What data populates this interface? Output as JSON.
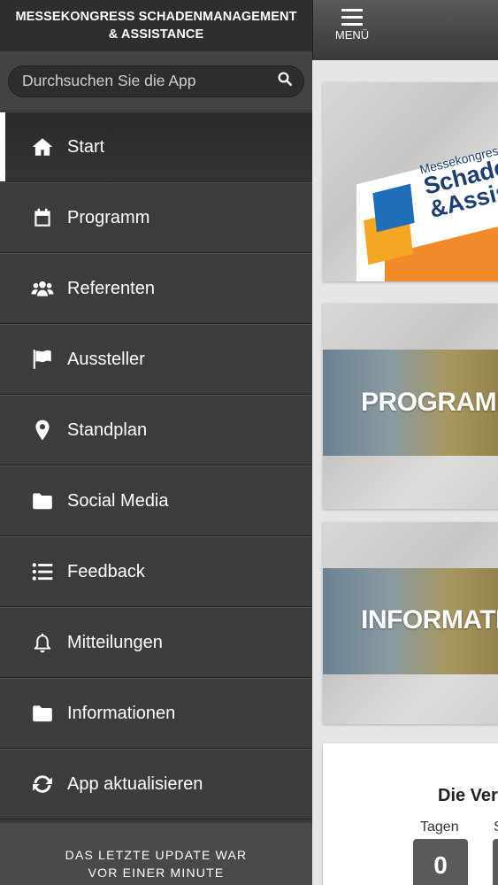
{
  "sidebar": {
    "title_line1": "MESSEKONGRESS SCHADENMANAGEMENT",
    "title_line2": "& ASSISTANCE",
    "search": {
      "placeholder": "Durchsuchen Sie die App",
      "value": ""
    },
    "items": [
      {
        "label": "Start",
        "icon": "home-icon",
        "active": true
      },
      {
        "label": "Programm",
        "icon": "calendar-icon"
      },
      {
        "label": "Referenten",
        "icon": "users-icon"
      },
      {
        "label": "Aussteller",
        "icon": "flag-icon"
      },
      {
        "label": "Standplan",
        "icon": "map-marker-icon"
      },
      {
        "label": "Social Media",
        "icon": "folder-icon"
      },
      {
        "label": "Feedback",
        "icon": "list-icon"
      },
      {
        "label": "Mitteilungen",
        "icon": "bell-icon"
      },
      {
        "label": "Informationen",
        "icon": "folder-icon"
      },
      {
        "label": "App aktualisieren",
        "icon": "refresh-icon"
      }
    ],
    "footer_line1": "DAS LETZTE UPDATE WAR",
    "footer_line2": "VOR EINER MINUTE"
  },
  "topbar": {
    "menu_label": "MENÜ"
  },
  "content": {
    "logo": {
      "line1": "Messekongress",
      "line2": "Schaden",
      "line3": "&Assist"
    },
    "tile_programm": "PROGRAMM",
    "tile_information": "INFORMATION",
    "countdown": {
      "title": "Die Ver",
      "unit_days": "Tagen",
      "unit_next": "S",
      "days_value": "0"
    }
  },
  "colors": {
    "sidebar_bg": "#3b3939",
    "accent_orange": "#f08a2b",
    "accent_blue": "#1f6fb8"
  }
}
